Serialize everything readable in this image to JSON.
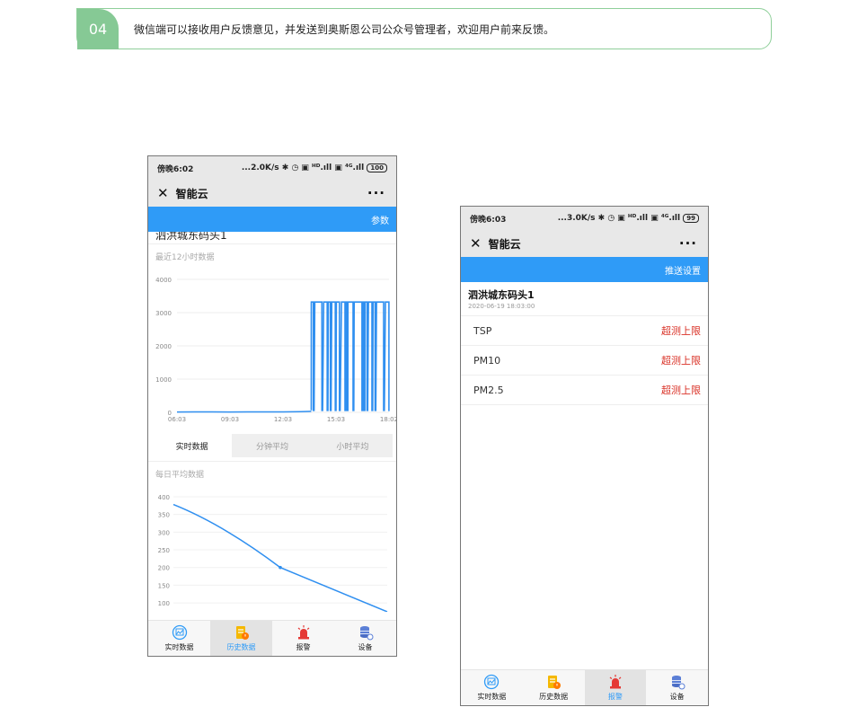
{
  "banner": {
    "number": "04",
    "text": "微信端可以接收用户反馈意见，并发送到奥斯恩公司公众号管理者，欢迎用户前来反馈。"
  },
  "phone1": {
    "status_time": "傍晚6:02",
    "status_right": "...2.0K/s ✱ ◷ ▣ ᴴᴰ.ıll ▣ ⁴ᴳ.ıll",
    "battery": "100",
    "app_title": "智能云",
    "more_label": "···",
    "blue_action": "参数",
    "site_name_partial": "泗洪城东码头1",
    "recent_label": "最近12小时数据",
    "segments": [
      "实时数据",
      "分钟平均",
      "小时平均"
    ],
    "daily_label": "每日平均数据",
    "tabs": [
      {
        "label": "实时数据",
        "icon": "chart-icon"
      },
      {
        "label": "历史数据",
        "icon": "history-doc-icon"
      },
      {
        "label": "报警",
        "icon": "alarm-siren-icon"
      },
      {
        "label": "设备",
        "icon": "device-database-icon"
      }
    ],
    "active_tab": 1
  },
  "phone2": {
    "status_time": "傍晚6:03",
    "status_right": "...3.0K/s ✱ ◷ ▣ ᴴᴰ.ıll ▣ ⁴ᴳ.ıll",
    "battery": "99",
    "app_title": "智能云",
    "more_label": "···",
    "blue_action": "推送设置",
    "site_name": "泗洪城东码头1",
    "site_time": "2020-06-19 18:03:00",
    "alarms": [
      {
        "name": "TSP",
        "status": "超测上限"
      },
      {
        "name": "PM10",
        "status": "超测上限"
      },
      {
        "name": "PM2.5",
        "status": "超测上限"
      }
    ],
    "tabs": [
      {
        "label": "实时数据",
        "icon": "chart-icon"
      },
      {
        "label": "历史数据",
        "icon": "history-doc-icon"
      },
      {
        "label": "报警",
        "icon": "alarm-siren-icon"
      },
      {
        "label": "设备",
        "icon": "device-database-icon"
      }
    ],
    "active_tab": 2
  },
  "colors": {
    "accent": "#2f9bf7",
    "alert": "#d93025",
    "banner_green": "#86c995"
  },
  "chart_data": [
    {
      "type": "line",
      "x_ticks": [
        "06:03",
        "09:03",
        "12:03",
        "15:03",
        "18:02"
      ],
      "y_ticks": [
        0,
        1000,
        2000,
        3000,
        4000
      ],
      "ylim": [
        0,
        4000
      ],
      "x_hours": [
        0,
        1,
        2,
        3,
        4,
        5,
        6,
        7,
        7.6,
        8,
        9,
        10,
        11,
        12
      ],
      "values": [
        10,
        15,
        12,
        10,
        12,
        14,
        13,
        20,
        30,
        3320,
        3330,
        3320,
        3330,
        3320
      ],
      "note_fluctuation": "from ~7.6h to 12h values alternate rapidly between ~0 and ~3320"
    },
    {
      "type": "line",
      "y_ticks": [
        100,
        150,
        200,
        250,
        300,
        350,
        400
      ],
      "ylim": [
        80,
        410
      ],
      "x": [
        0,
        1,
        2
      ],
      "values": [
        378,
        200,
        75
      ]
    }
  ]
}
